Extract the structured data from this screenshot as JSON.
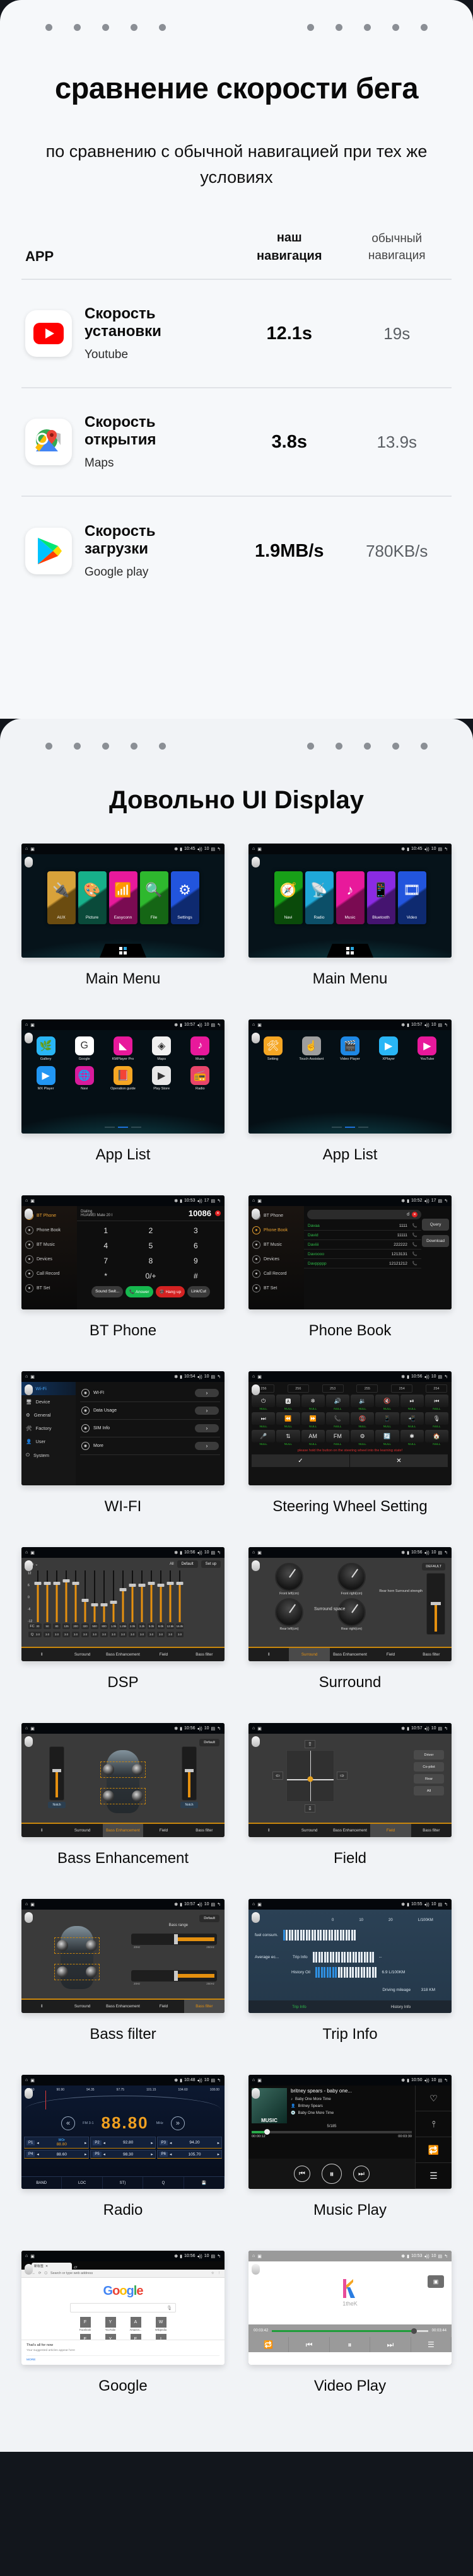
{
  "comparison_card": {
    "title": "сравнение скорости бега",
    "subtitle": "по сравнению с обычной навигацией при тех же условиях",
    "table": {
      "headers": {
        "app": "APP",
        "ours_line1": "наш",
        "ours_line2": "навигация",
        "normal_line1": "обычный",
        "normal_line2": "навигация"
      },
      "rows": [
        {
          "icon": "youtube-icon",
          "metric": "Скорость установки",
          "app": "Youtube",
          "ours": "12.1s",
          "normal": "19s"
        },
        {
          "icon": "google-maps-icon",
          "metric": "Скорость открытия",
          "app": "Maps",
          "ours": "3.8s",
          "normal": "13.9s"
        },
        {
          "icon": "google-play-icon",
          "metric": "Скорость загрузки",
          "app": "Google play",
          "ours": "1.9MB/s",
          "normal": "780KB/s"
        }
      ]
    }
  },
  "ui_display_card": {
    "title": "Довольно UI Display",
    "cells": [
      {
        "label": "Main Menu",
        "kind": "main-menu-a",
        "status_time": "10:45",
        "status_vol": "10",
        "tiles": [
          {
            "name": "AUX",
            "glyph": "🔌",
            "color1": "#d8a23a",
            "color2": "#6b4c10"
          },
          {
            "name": "Picture",
            "glyph": "🎨",
            "color1": "#17b08a",
            "color2": "#0a4a3a"
          },
          {
            "name": "Easyconn",
            "glyph": "📶",
            "color1": "#e8199b",
            "color2": "#7a0b52"
          },
          {
            "name": "File",
            "glyph": "🔍",
            "color1": "#2eb82e",
            "color2": "#156615"
          },
          {
            "name": "Settings",
            "glyph": "⚙",
            "color1": "#2255dd",
            "color2": "#0e2a70"
          }
        ]
      },
      {
        "label": "Main Menu",
        "kind": "main-menu-b",
        "status_time": "10:45",
        "status_vol": "10",
        "tiles": [
          {
            "name": "Navi",
            "glyph": "🧭",
            "color1": "#18a018",
            "color2": "#0a4a0a"
          },
          {
            "name": "Radio",
            "glyph": "📡",
            "color1": "#1fa8d8",
            "color2": "#0c4f68"
          },
          {
            "name": "Music",
            "glyph": "♪",
            "color1": "#e8199b",
            "color2": "#7a0b52"
          },
          {
            "name": "Bluetooth",
            "glyph": "📱",
            "color1": "#8a2be2",
            "color2": "#451470"
          },
          {
            "name": "Video",
            "glyph": "🎞",
            "color1": "#2255dd",
            "color2": "#0e2a70"
          }
        ]
      },
      {
        "label": "App List",
        "kind": "app-list-a",
        "status_time": "10:57",
        "status_vol": "10",
        "apps_row1": [
          {
            "name": "Gallery",
            "glyph": "🌿",
            "color": "#29b6f6"
          },
          {
            "name": "Google",
            "glyph": "G",
            "color": "#ffffff"
          },
          {
            "name": "KMPlayer Pro",
            "glyph": "◣",
            "color": "#e8199b"
          },
          {
            "name": "Maps",
            "glyph": "◈",
            "color": "#f1f1f1"
          },
          {
            "name": "Music",
            "glyph": "♪",
            "color": "#e8199b"
          }
        ],
        "apps_row2": [
          {
            "name": "MX Player",
            "glyph": "▶",
            "color": "#2196f3"
          },
          {
            "name": "Navi",
            "glyph": "🌐",
            "color": "#d81b9b"
          },
          {
            "name": "Operation guide",
            "glyph": "📕",
            "color": "#f5a623"
          },
          {
            "name": "Play Store",
            "glyph": "▶",
            "color": "#e8e8e8"
          },
          {
            "name": "Radio",
            "glyph": "📻",
            "color": "#e8456a"
          }
        ]
      },
      {
        "label": "App List",
        "kind": "app-list-b",
        "status_time": "10:57",
        "status_vol": "10",
        "apps_row1": [
          {
            "name": "Setting",
            "glyph": "🛠",
            "color": "#f5a623"
          },
          {
            "name": "Touch Assistant",
            "glyph": "☝",
            "color": "#9e9e9e"
          },
          {
            "name": "Video Player",
            "glyph": "🎬",
            "color": "#1e88e5"
          },
          {
            "name": "XPlayer",
            "glyph": "▶",
            "color": "#29b6f6"
          },
          {
            "name": "YouTube",
            "glyph": "▶",
            "color": "#e8199b"
          }
        ],
        "apps_row2": []
      },
      {
        "label": "BT Phone",
        "kind": "bt-phone",
        "status_time": "10:53",
        "status_vol": "17",
        "sidebar": [
          "BT Phone",
          "Phone Book",
          "BT Music",
          "Devices",
          "Call Record",
          "BT Set"
        ],
        "status_line1": "Dialing",
        "status_line2": "HUAWEI Mate 20 I",
        "number": "10086",
        "number_badge": "10086",
        "keys": [
          "1",
          "2",
          "3",
          "4",
          "5",
          "6",
          "7",
          "8",
          "9",
          "*",
          "0/+",
          "#"
        ],
        "actions": [
          "Sound Swit...",
          "Answer",
          "Hang up",
          "Link/Cut"
        ]
      },
      {
        "label": "Phone Book",
        "kind": "phone-book",
        "status_time": "10:52",
        "status_vol": "17",
        "sidebar": [
          "BT Phone",
          "Phone Book",
          "BT Music",
          "Devices",
          "Call Record",
          "BT Set"
        ],
        "search_value": "d",
        "contacts": [
          {
            "name": "Davaa",
            "number": "1111"
          },
          {
            "name": "David",
            "number": "11111"
          },
          {
            "name": "Daviiii",
            "number": "222222"
          },
          {
            "name": "Davoooo",
            "number": "1213131"
          },
          {
            "name": "Davppppp",
            "number": "12121212"
          }
        ],
        "buttons": [
          "Query",
          "Download"
        ]
      },
      {
        "label": "WI-FI",
        "kind": "wifi",
        "status_time": "10:54",
        "status_vol": "10",
        "sidebar": [
          "Wi-Fi",
          "Device",
          "General",
          "Factory",
          "User",
          "System"
        ],
        "rows": [
          "WI-FI",
          "Data Usage",
          "SIM Info",
          "More"
        ]
      },
      {
        "label": "Steering Wheel Setting",
        "kind": "steering",
        "status_time": "10:56",
        "status_vol": "10",
        "values": [
          "256",
          "256",
          "253",
          "255",
          "254",
          "254"
        ],
        "keys": [
          "⏻",
          "🅰",
          "❄",
          "🔊",
          "🔉",
          "🔇",
          "⏯",
          "⏮",
          "⏭",
          "⏪",
          "⏩",
          "📞",
          "📵",
          "📱",
          "📲",
          "🎙",
          "🎤",
          "⇅",
          "AM",
          "FM",
          "⚙",
          "🔄",
          "✱",
          "🏠"
        ],
        "key_label": "NULL",
        "warning": "please hold the button on the steering wheel into the learning state!",
        "confirm": "✓",
        "cancel": "✕"
      },
      {
        "label": "DSP",
        "kind": "dsp",
        "status_time": "10:56",
        "status_vol": "10",
        "preset": "Rock",
        "all_label": "All",
        "btn_default": "Default",
        "btn_setup": "Set up",
        "axis": [
          "12",
          "6",
          "0",
          "-6",
          "-12"
        ],
        "fc_label": "FC",
        "q_label": "Q",
        "fc": [
          "30",
          "50",
          "80",
          "125",
          "200",
          "320",
          "500",
          "800",
          "1.0k",
          "1.25k",
          "2.0k",
          "3.2k",
          "5.0k",
          "8.0k",
          "12.5k",
          "16.0k"
        ],
        "q": [
          "3.0",
          "3.0",
          "3.0",
          "3.0",
          "3.0",
          "3.0",
          "3.0",
          "3.0",
          "3.0",
          "3.0",
          "3.0",
          "3.0",
          "3.0",
          "3.0",
          "3.0",
          "3.0"
        ],
        "levels": [
          6,
          6,
          6,
          7,
          6,
          -2,
          -4,
          -4,
          -3,
          3,
          5,
          5,
          6,
          5,
          6,
          6
        ],
        "tabs": [
          "Surround",
          "Bass Enhancement",
          "Field",
          "Bass filter"
        ],
        "active_tab": ""
      },
      {
        "label": "Surround",
        "kind": "surround",
        "status_time": "10:56",
        "status_vol": "10",
        "dials": [
          "Front left(cm)",
          "Front right(cm)",
          "Rear left(cm)",
          "Rear right(cm)"
        ],
        "center_label": "Surround space",
        "right_label": "Rear horn Surround strength",
        "btn_default": "DEFAULT",
        "tabs": [
          "Surround",
          "Bass Enhancement",
          "Field",
          "Bass filter"
        ],
        "active_tab": "Surround"
      },
      {
        "label": "Bass Enhancement",
        "kind": "bass-enh",
        "status_time": "10:56",
        "status_vol": "10",
        "btn_default": "Default",
        "vlabel": "Notch",
        "tabs": [
          "Surround",
          "Bass Enhancement",
          "Field",
          "Bass filter"
        ],
        "active_tab": "Bass Enhancement"
      },
      {
        "label": "Field",
        "kind": "field",
        "status_time": "10:57",
        "status_vol": "10",
        "buttons": [
          "Driver",
          "Co-pilot",
          "Rear",
          "All"
        ],
        "tabs": [
          "Surround",
          "Bass Enhancement",
          "Field",
          "Bass filter"
        ],
        "active_tab": "Field"
      },
      {
        "label": "Bass filter",
        "kind": "bass-filter",
        "status_time": "10:57",
        "status_vol": "10",
        "btn_default": "Default",
        "range_label": "Bass range",
        "slider_min": "20Hz",
        "slider_max": "250Hz",
        "tabs": [
          "Surround",
          "Bass Enhancement",
          "Field",
          "Bass filter"
        ],
        "active_tab": "Bass filter"
      },
      {
        "label": "Trip Info",
        "kind": "trip",
        "status_time": "10:55",
        "status_vol": "10",
        "scale": [
          "0",
          "10",
          "20",
          "L/100KM"
        ],
        "fuel_label": "fuel consum.",
        "avg_label": "Average ec...",
        "trip_label": "Trip Info",
        "trip_value": "--",
        "history_label": "History Oil",
        "history_value": "6.9 L/100KM",
        "mileage_label": "Driving mileage",
        "mileage_value": "318 KM",
        "tabs": [
          "Trip Info",
          "History Info"
        ],
        "active_tab": "Trip Info"
      },
      {
        "label": "Radio",
        "kind": "radio",
        "status_time": "10:48",
        "status_vol": "10",
        "ticks": [
          "87.50",
          "90.90",
          "94.35",
          "97.75",
          "101.15",
          "104.60",
          "108.00"
        ],
        "frequency": "88.80",
        "band": "FM 3-1",
        "unit": "MHz",
        "presets": [
          {
            "id": "P1",
            "value": "88.80",
            "name": "WOr"
          },
          {
            "id": "P2",
            "value": "92.80",
            "name": ""
          },
          {
            "id": "P3",
            "value": "94.20",
            "name": ""
          },
          {
            "id": "P4",
            "value": "88.60",
            "name": ""
          },
          {
            "id": "P5",
            "value": "98.30",
            "name": ""
          },
          {
            "id": "P6",
            "value": "105.70",
            "name": ""
          }
        ],
        "bottom": [
          "BAND",
          "LOC",
          "ST)",
          "Q",
          "💾"
        ]
      },
      {
        "label": "Music Play",
        "kind": "music",
        "status_time": "10:50",
        "status_vol": "10",
        "title": "britney spears - baby one...",
        "meta": [
          {
            "icon": "note-icon",
            "text": "Baby One More Time"
          },
          {
            "icon": "artist-icon",
            "text": "Britney Spears"
          },
          {
            "icon": "album-icon",
            "text": "Baby One More Time"
          }
        ],
        "count": "5/185",
        "time_current": "00:00:12",
        "time_total": "00:03:30",
        "side_buttons": [
          "♡",
          "⫯",
          "🔁",
          "☰"
        ],
        "cover_text": "MUSIC"
      },
      {
        "label": "Google",
        "kind": "google",
        "status_time": "10:56",
        "status_vol": "10",
        "tab_title": "新标签",
        "url_placeholder": "Search or type web address",
        "logo": "Google",
        "tiles": [
          {
            "letter": "F",
            "name": "Facebook"
          },
          {
            "letter": "Y",
            "name": "YouTube"
          },
          {
            "letter": "A",
            "name": "Amazon..."
          },
          {
            "letter": "W",
            "name": "Wikipedia"
          },
          {
            "letter": "E",
            "name": "ESPN.com"
          },
          {
            "letter": "Y",
            "name": "Yahoo"
          },
          {
            "letter": "E",
            "name": "eBay"
          },
          {
            "letter": "I",
            "name": "Instagram"
          }
        ],
        "feed_title": "That's all for now",
        "feed_sub": "Your suggested articles appear here",
        "feed_more": "MORE"
      },
      {
        "label": "Video Play",
        "kind": "video",
        "status_time": "10:53",
        "status_vol": "10",
        "channel": "1theK",
        "time_current": "00:03:42",
        "time_total": "00:03:44",
        "controls": [
          "🔁",
          "⏮",
          "⏸",
          "⏭",
          "☰"
        ]
      }
    ]
  }
}
